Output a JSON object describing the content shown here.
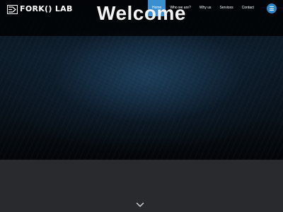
{
  "brand": {
    "logo_text": "FORK() LAB"
  },
  "nav": {
    "items": [
      {
        "label": "Home",
        "active": true
      },
      {
        "label": "Who we are?",
        "active": false
      },
      {
        "label": "Why us",
        "active": false
      },
      {
        "label": "Services",
        "active": false
      },
      {
        "label": "Contact",
        "active": false
      }
    ],
    "toggle_icon": "hamburger-menu-icon"
  },
  "hero": {
    "title": "Welcome",
    "scroll_icon": "chevron-down-icon"
  },
  "colors": {
    "accent": "#3a8fd0",
    "lower_band": "#282a2e"
  }
}
